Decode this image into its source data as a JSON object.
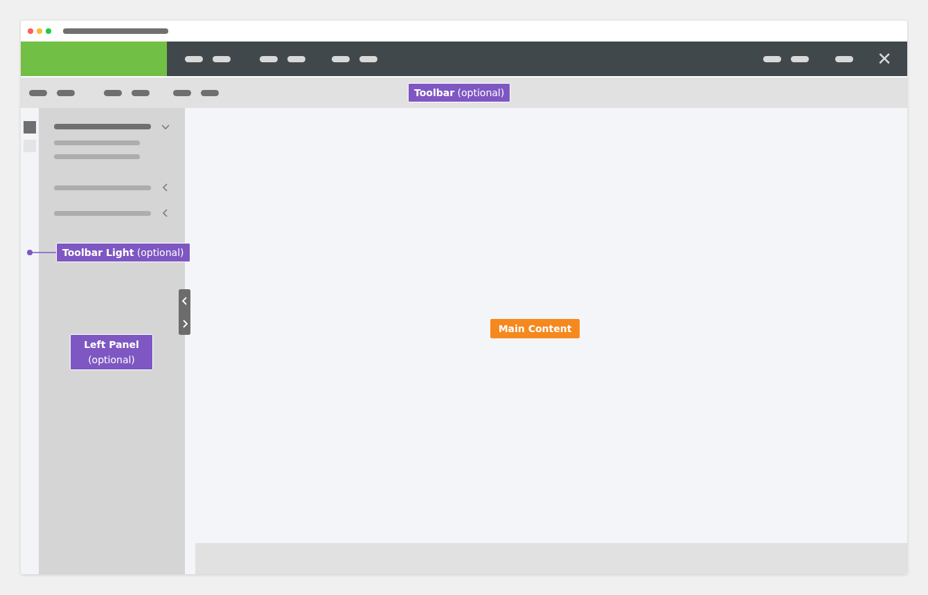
{
  "header": {
    "close_icon": "✕"
  },
  "toolbar_light": {
    "items": [
      {
        "selected": true
      },
      {
        "selected": false
      }
    ]
  },
  "left_panel": {
    "items": [
      {
        "expanded": true
      },
      {
        "expanded": false
      },
      {
        "expanded": false
      }
    ]
  },
  "annotations": [
    {
      "kind": "toolbar",
      "text": "**Toolbar** (optional)"
    },
    {
      "kind": "toolbar-light",
      "text": "**Toolbar Light** (optional)"
    },
    {
      "kind": "left-panel",
      "text": "**Left Panel** (optional)"
    },
    {
      "kind": "main",
      "text": "Main Content"
    }
  ]
}
